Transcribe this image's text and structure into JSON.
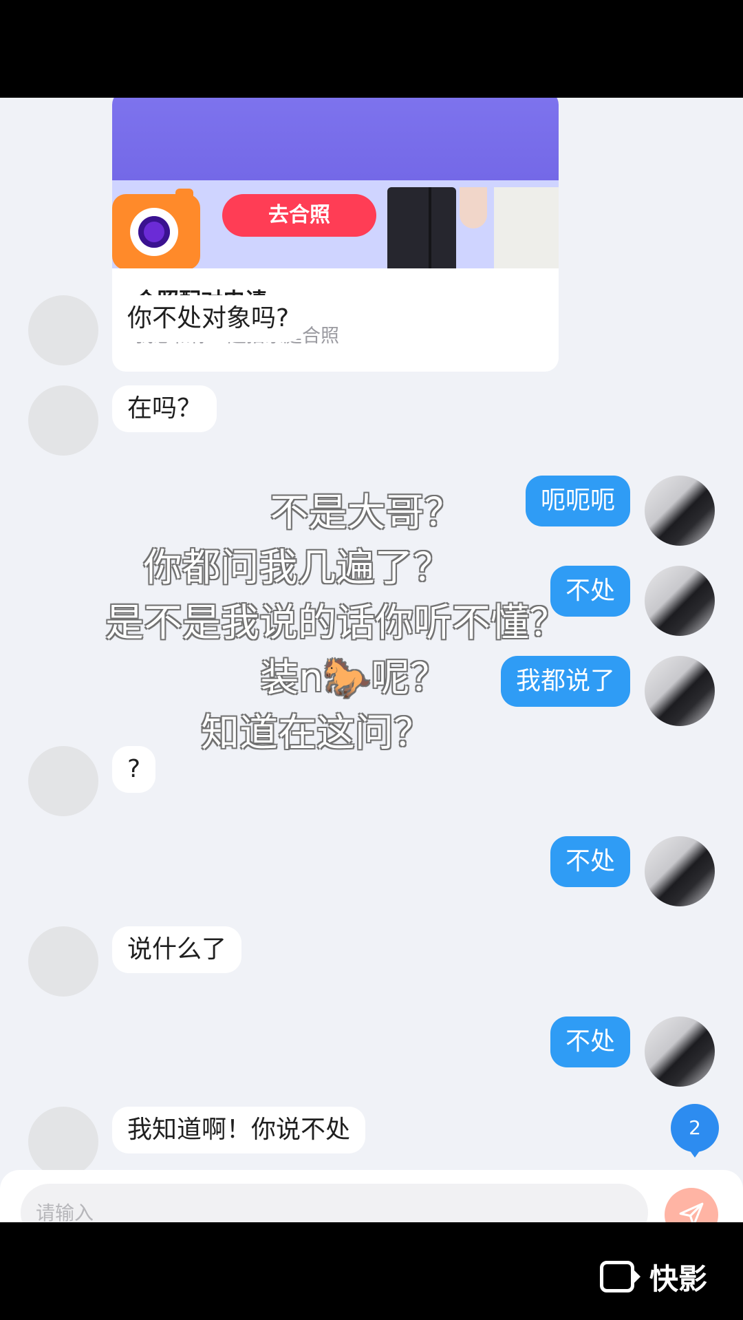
{
  "card": {
    "button_label": "去合照",
    "title": "合照配对申请",
    "subtitle": "我想和你一起拍家庭合照"
  },
  "messages": [
    {
      "side": "left",
      "text": "你不处对象吗?"
    },
    {
      "side": "left",
      "text": "在吗？"
    },
    {
      "side": "right",
      "text": "呃呃呃"
    },
    {
      "side": "right",
      "text": "不处"
    },
    {
      "side": "right",
      "text": "我都说了"
    },
    {
      "side": "left",
      "text": "?"
    },
    {
      "side": "right",
      "text": "不处"
    },
    {
      "side": "left",
      "text": "说什么了"
    },
    {
      "side": "right",
      "text": "不处"
    },
    {
      "side": "left",
      "text": "我知道啊！你说不处"
    }
  ],
  "unread_badge": "2",
  "input": {
    "placeholder": "请输入"
  },
  "overlay_caption": [
    "不是大哥？",
    "你都问我几遍了？",
    "是不是我说的话你听不懂？",
    "装n🐎呢？",
    "知道在这问？"
  ],
  "watermark": {
    "text": "快影"
  },
  "colors": {
    "chat_background": "#f0f2f7",
    "sent_bubble": "#2f9cf5",
    "received_bubble": "#ffffff",
    "badge": "#2d8cf0",
    "send_button": "#ffb4a4"
  }
}
